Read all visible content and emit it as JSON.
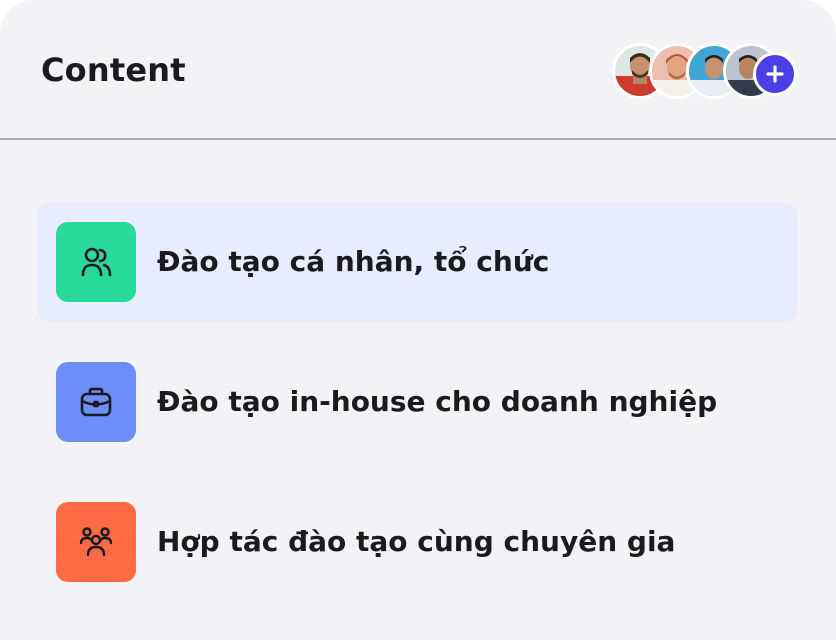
{
  "header": {
    "title": "Content",
    "avatars": [
      {
        "name": "avatar-1",
        "bg": "#cf3b2c"
      },
      {
        "name": "avatar-2",
        "bg": "#eebfaf"
      },
      {
        "name": "avatar-3",
        "bg": "#3fa6d6"
      },
      {
        "name": "avatar-4",
        "bg": "#bcc3cf"
      }
    ],
    "add_icon": "plus-icon",
    "add_color": "#4d3fe6"
  },
  "menu": {
    "items": [
      {
        "label": "Đào tạo cá nhân, tổ chức",
        "icon": "users-icon",
        "color": "#28d99a",
        "active": true
      },
      {
        "label": "Đào tạo in-house cho doanh nghiệp",
        "icon": "briefcase-icon",
        "color": "#6e8dfb",
        "active": false
      },
      {
        "label": "Hợp tác đào tạo cùng chuyên gia",
        "icon": "team-icon",
        "color": "#ff6b45",
        "active": false
      }
    ]
  }
}
